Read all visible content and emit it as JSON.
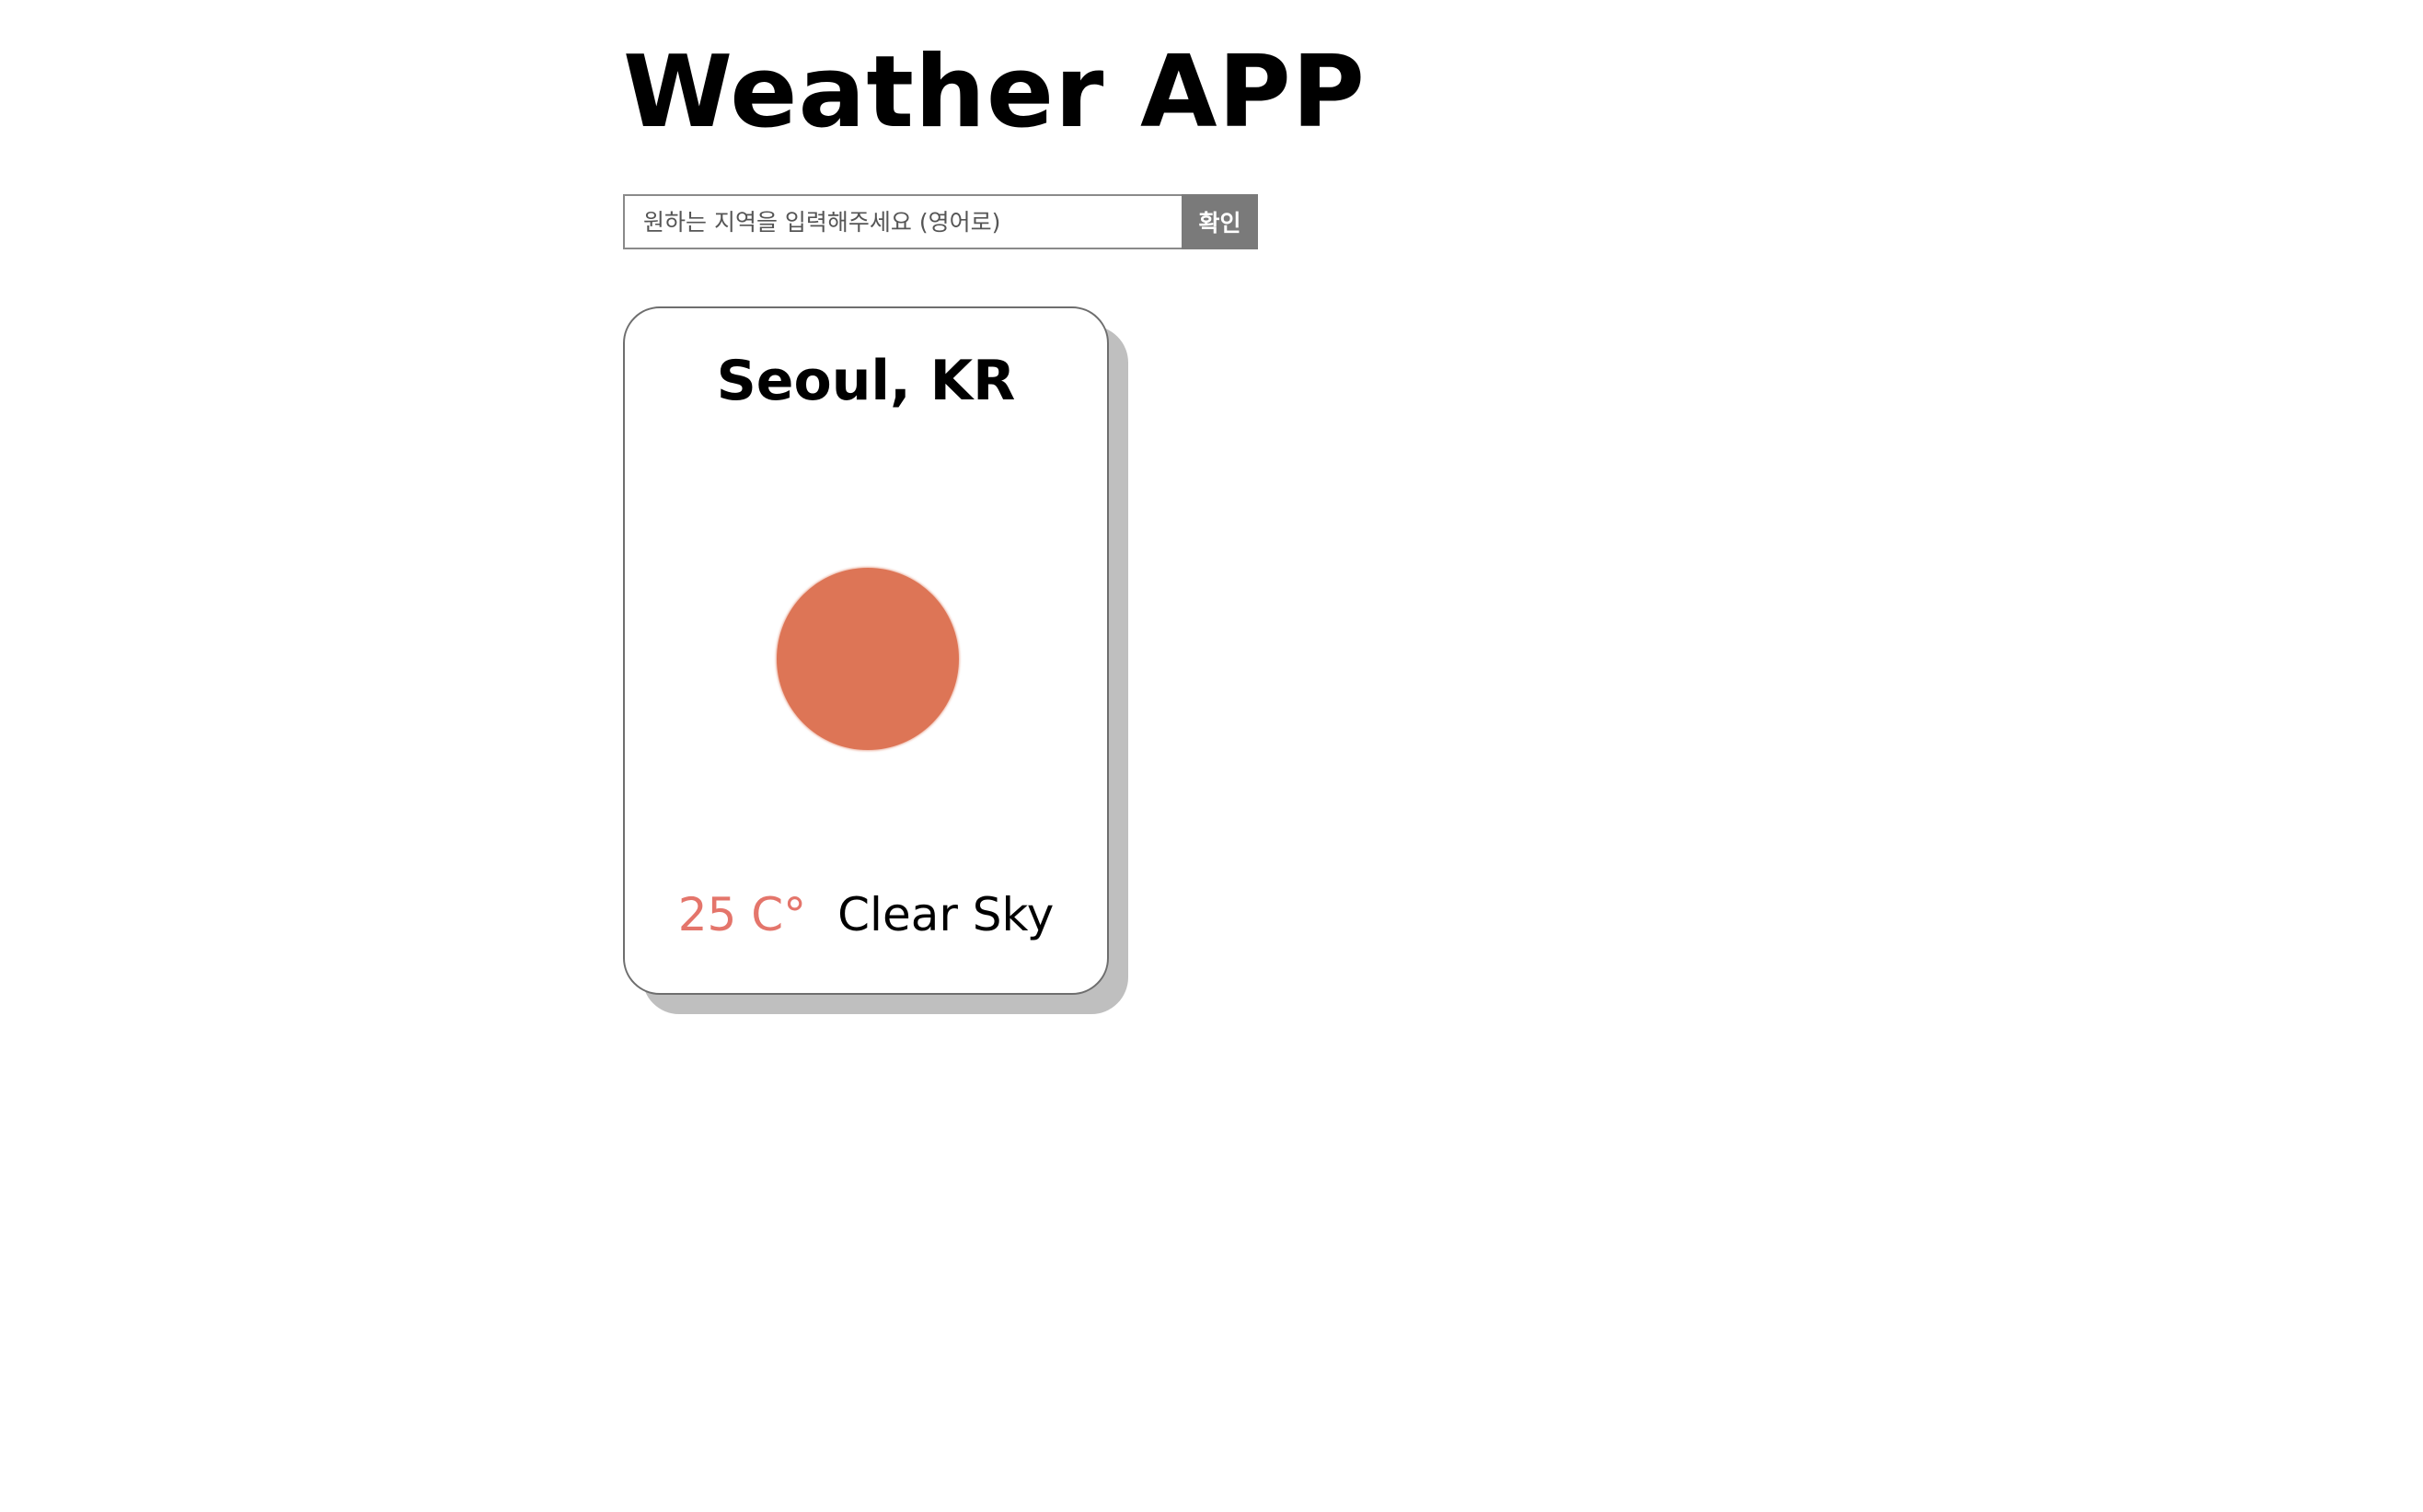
{
  "app": {
    "title": "Weather APP"
  },
  "search": {
    "placeholder": "원하는 지역을 입력해주세요 (영어로)",
    "value": "",
    "submit_label": "확인"
  },
  "weather": {
    "city": "Seoul, KR",
    "temperature": "25 C°",
    "description": "Clear Sky",
    "icon": "sun-icon"
  },
  "colors": {
    "sun": "#dd7556",
    "temperature": "#e4756b",
    "button": "#7a7a7a",
    "card_shadow": "#bfbfbf"
  }
}
